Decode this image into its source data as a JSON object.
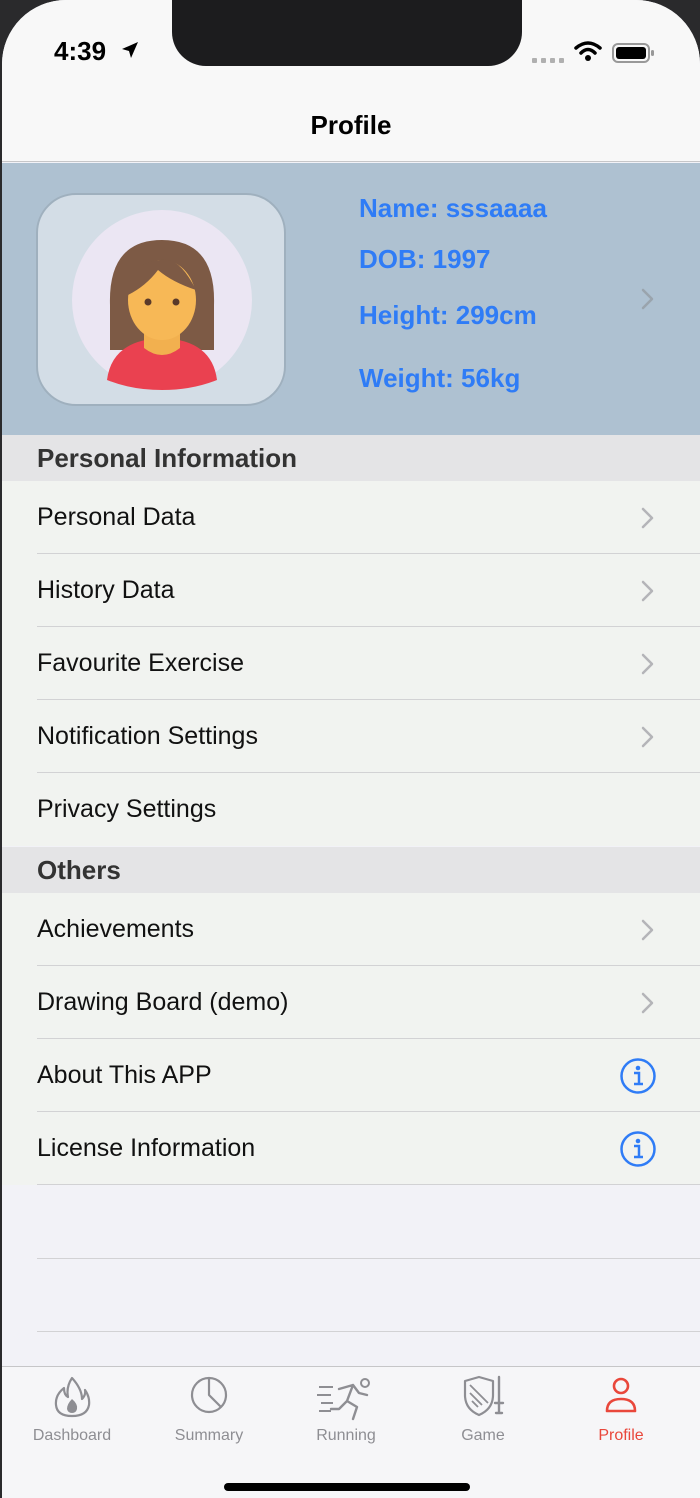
{
  "status_bar": {
    "time": "4:39"
  },
  "nav": {
    "title": "Profile"
  },
  "profile": {
    "name": "Name: sssaaaa",
    "dob": "DOB: 1997",
    "height": "Height: 299cm",
    "weight": "Weight: 56kg"
  },
  "sections": {
    "personal": {
      "header": "Personal Information",
      "items": [
        {
          "label": "Personal Data",
          "accessory": "chevron-right-icon"
        },
        {
          "label": "History Data",
          "accessory": "chevron-right-icon"
        },
        {
          "label": "Favourite Exercise",
          "accessory": "chevron-right-icon"
        },
        {
          "label": "Notification Settings",
          "accessory": "chevron-right-icon"
        },
        {
          "label": "Privacy Settings",
          "accessory": "none"
        }
      ]
    },
    "others": {
      "header": "Others",
      "items": [
        {
          "label": "Achievements",
          "accessory": "chevron-right-icon"
        },
        {
          "label": "Drawing Board (demo)",
          "accessory": "chevron-right-icon"
        },
        {
          "label": "About This APP",
          "accessory": "info-icon"
        },
        {
          "label": "License Information",
          "accessory": "info-icon"
        }
      ]
    }
  },
  "tabbar": {
    "tabs": [
      {
        "label": "Dashboard",
        "icon": "flame-icon",
        "active": false
      },
      {
        "label": "Summary",
        "icon": "pie-chart-icon",
        "active": false
      },
      {
        "label": "Running",
        "icon": "runner-icon",
        "active": false
      },
      {
        "label": "Game",
        "icon": "shield-sword-icon",
        "active": false
      },
      {
        "label": "Profile",
        "icon": "person-icon",
        "active": true
      }
    ]
  },
  "colors": {
    "accent_blue": "#2f7cf6",
    "active_tab": "#e9473b",
    "profile_card_bg": "#aec1d1"
  }
}
